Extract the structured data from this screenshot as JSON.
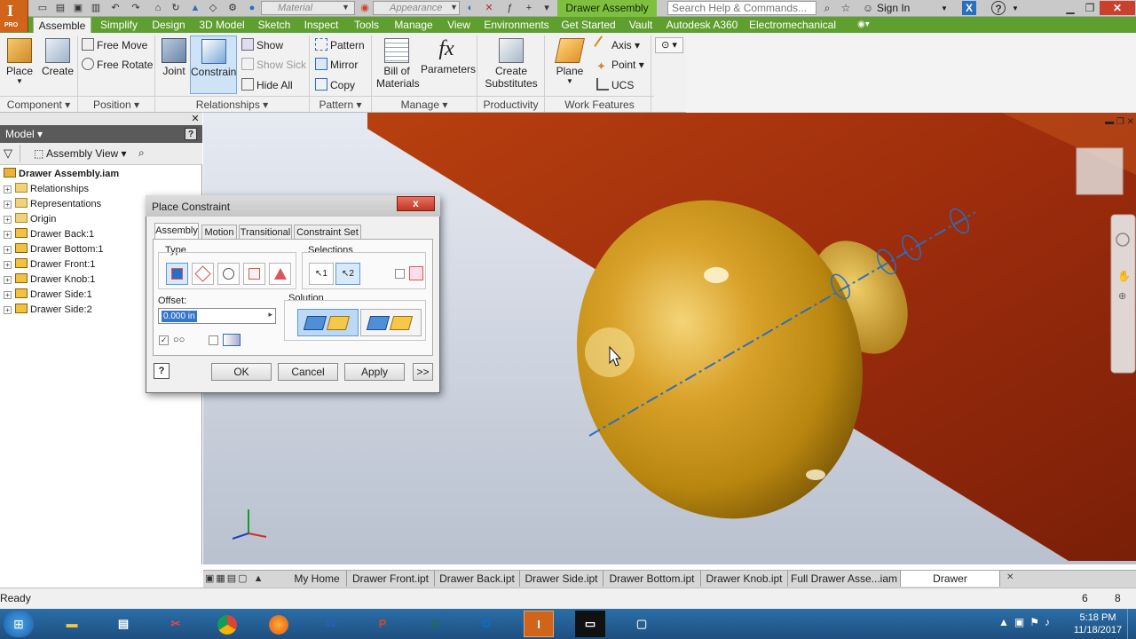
{
  "app": {
    "name_glyph": "I",
    "edition": "PRO"
  },
  "title_bar": {
    "material_placeholder": "Material",
    "appearance_placeholder": "Appearance",
    "document_title": "Drawer Assembly",
    "search_placeholder": "Search Help & Commands...",
    "sign_in": "Sign In"
  },
  "ribbon_tabs": [
    "Assemble",
    "Simplify",
    "Design",
    "3D Model",
    "Sketch",
    "Inspect",
    "Tools",
    "Manage",
    "View",
    "Environments",
    "Get Started",
    "Vault",
    "Autodesk A360",
    "Electromechanical"
  ],
  "ribbon": {
    "component": {
      "label": "Component",
      "place": "Place",
      "create": "Create"
    },
    "position": {
      "label": "Position",
      "free_move": "Free Move",
      "free_rotate": "Free Rotate"
    },
    "relationships": {
      "label": "Relationships",
      "joint": "Joint",
      "constrain": "Constrain",
      "show": "Show",
      "show_sick": "Show Sick",
      "hide_all": "Hide All"
    },
    "pattern": {
      "label": "Pattern",
      "pattern": "Pattern",
      "mirror": "Mirror",
      "copy": "Copy"
    },
    "manage": {
      "label": "Manage",
      "bom": "Bill of",
      "bom2": "Materials",
      "parameters": "Parameters",
      "fx": "fx"
    },
    "productivity": {
      "label": "Productivity",
      "create": "Create",
      "substitutes": "Substitutes"
    },
    "work_features": {
      "label": "Work Features",
      "plane": "Plane",
      "axis": "Axis",
      "point": "Point",
      "ucs": "UCS"
    }
  },
  "browser": {
    "title": "Model",
    "view": "Assembly View",
    "help": "?",
    "root": "Drawer Assembly.iam",
    "items": [
      "Relationships",
      "Representations",
      "Origin",
      "Drawer Back:1",
      "Drawer Bottom:1",
      "Drawer Front:1",
      "Drawer Knob:1",
      "Drawer Side:1",
      "Drawer Side:2"
    ]
  },
  "dialog": {
    "title": "Place Constraint",
    "tabs": [
      "Assembly",
      "Motion",
      "Transitional",
      "Constraint Set"
    ],
    "type_label": "Type",
    "selections_label": "Selections",
    "sel1": "1",
    "sel2": "2",
    "offset_label": "Offset:",
    "offset_value": "0.000 in",
    "solution_label": "Solution",
    "ok": "OK",
    "cancel": "Cancel",
    "apply": "Apply",
    "more": ">>",
    "help": "?",
    "close": "x"
  },
  "doc_tabs": [
    "My Home",
    "Drawer Front.ipt",
    "Drawer Back.ipt",
    "Drawer Side.ipt",
    "Drawer Bottom.ipt",
    "Drawer Knob.ipt",
    "Full Drawer Asse...iam",
    "Drawer Assembly.iam"
  ],
  "status": {
    "text": "Ready",
    "count_a": "6",
    "count_b": "8"
  },
  "taskbar": {
    "time": "5:18 PM",
    "date": "11/18/2017"
  },
  "colors": {
    "ribbon_green": "#5f9f2f",
    "title_green": "#7fbf3f",
    "knob_gold": "#c9961a",
    "wood": "#a8320f",
    "axis_blue": "#2a6fbf"
  }
}
